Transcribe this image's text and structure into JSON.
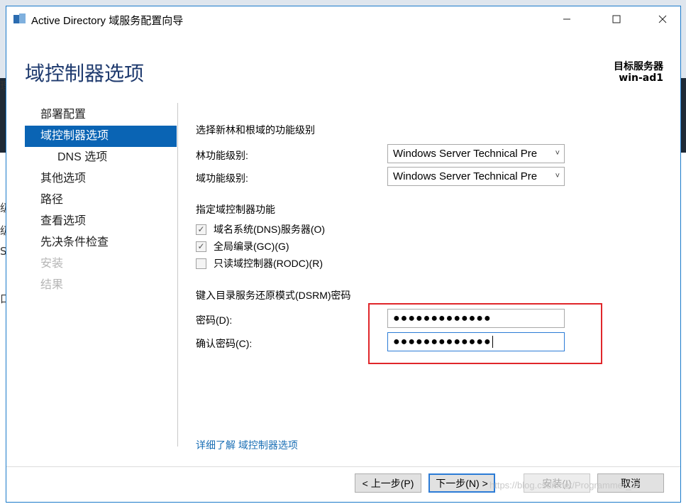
{
  "window": {
    "title": "Active Directory 域服务配置向导"
  },
  "header": {
    "page_title": "域控制器选项",
    "target_label": "目标服务器",
    "target_server": "win-ad1"
  },
  "nav": {
    "items": [
      {
        "label": "部署配置",
        "state": "normal"
      },
      {
        "label": "域控制器选项",
        "state": "active"
      },
      {
        "label": "DNS 选项",
        "state": "sub"
      },
      {
        "label": "其他选项",
        "state": "normal"
      },
      {
        "label": "路径",
        "state": "normal"
      },
      {
        "label": "查看选项",
        "state": "normal"
      },
      {
        "label": "先决条件检查",
        "state": "normal"
      },
      {
        "label": "安装",
        "state": "disabled"
      },
      {
        "label": "结果",
        "state": "disabled"
      }
    ]
  },
  "content": {
    "section_functional_level": "选择新林和根域的功能级别",
    "forest_level_label": "林功能级别:",
    "forest_level_value": "Windows Server Technical Pre",
    "domain_level_label": "域功能级别:",
    "domain_level_value": "Windows Server Technical Pre",
    "section_capabilities": "指定域控制器功能",
    "capabilities": [
      {
        "label": "域名系统(DNS)服务器(O)",
        "checked": true
      },
      {
        "label": "全局编录(GC)(G)",
        "checked": true
      },
      {
        "label": "只读域控制器(RODC)(R)",
        "checked": false
      }
    ],
    "section_dsrm": "键入目录服务还原模式(DSRM)密码",
    "password_label": "密码(D):",
    "password_value": "●●●●●●●●●●●●●",
    "confirm_label": "确认密码(C):",
    "confirm_value": "●●●●●●●●●●●●●",
    "learn_more": "详细了解 域控制器选项"
  },
  "footer": {
    "prev": "< 上一步(P)",
    "next": "下一步(N) >",
    "install": "安装(I)",
    "cancel": "取消"
  },
  "watermark": "https://blog.csdn.net/Programmer_Jz",
  "colors": {
    "accent": "#0a64b4",
    "title": "#1e3a6e",
    "highlight_box": "#e0262a",
    "link": "#1a6fb5"
  },
  "background_glyphs": [
    "理",
    "叙",
    "级",
    "级",
    "S",
    "口"
  ]
}
